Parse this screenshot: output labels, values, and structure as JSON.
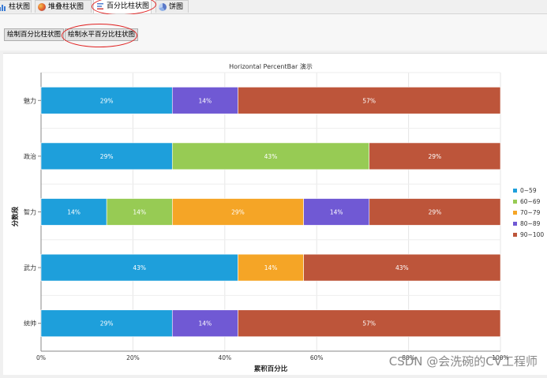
{
  "tabs": [
    {
      "label": "柱状图",
      "icon": "bar-chart-icon"
    },
    {
      "label": "堆叠柱状图",
      "icon": "stacked-bar-chart-icon"
    },
    {
      "label": "百分比柱状图",
      "icon": "percent-bar-chart-icon"
    },
    {
      "label": "饼图",
      "icon": "pie-chart-icon"
    }
  ],
  "active_tab": 2,
  "toolbar": {
    "btn_vertical": "绘制百分比柱状图",
    "btn_horizontal": "绘制水平百分比柱状图"
  },
  "watermark": "CSDN @会洗碗的CV工程师",
  "colors": {
    "0~59": "#1e9fdb",
    "60~69": "#97cb54",
    "70~79": "#f5a526",
    "80~89": "#7059d4",
    "90~100": "#bd553a",
    "annotation": "#e02020"
  },
  "chart_data": {
    "type": "bar",
    "orientation": "horizontal",
    "stacked": "percent",
    "title": "Horizontal PercentBar 演示",
    "xlabel": "累积百分比",
    "ylabel": "分数段",
    "categories": [
      "魅力",
      "政治",
      "智力",
      "武力",
      "统帅"
    ],
    "xlim": [
      0,
      100
    ],
    "xticks": [
      "0%",
      "20%",
      "40%",
      "60%",
      "80%",
      "100%"
    ],
    "grid": true,
    "legend_position": "right",
    "series": [
      {
        "name": "0~59",
        "values": [
          28.57,
          28.57,
          14.29,
          42.86,
          28.57
        ],
        "labels": [
          "29%",
          "29%",
          "14%",
          "43%",
          "29%"
        ]
      },
      {
        "name": "60~69",
        "values": [
          0,
          42.86,
          14.29,
          0,
          0
        ],
        "labels": [
          "",
          "43%",
          "14%",
          "",
          ""
        ]
      },
      {
        "name": "70~79",
        "values": [
          0,
          0,
          28.57,
          14.29,
          0
        ],
        "labels": [
          "",
          "",
          "29%",
          "14%",
          ""
        ]
      },
      {
        "name": "80~89",
        "values": [
          14.29,
          0,
          14.29,
          0,
          14.29
        ],
        "labels": [
          "14%",
          "",
          "14%",
          "",
          "14%"
        ]
      },
      {
        "name": "90~100",
        "values": [
          57.14,
          28.57,
          28.57,
          42.86,
          57.14
        ],
        "labels": [
          "57%",
          "29%",
          "29%",
          "43%",
          "57%"
        ]
      }
    ]
  }
}
